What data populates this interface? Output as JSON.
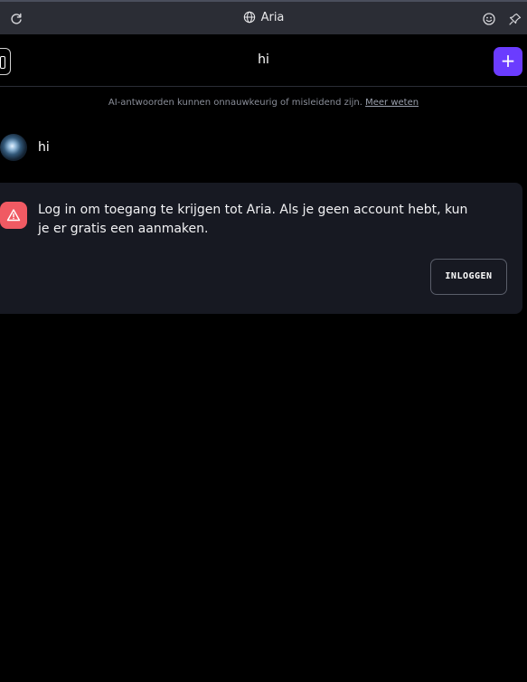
{
  "window": {
    "title": "Aria",
    "icons": {
      "reload": "reload-icon",
      "globe": "globe-icon",
      "emoji": "emoji-icon",
      "pin": "pin-icon"
    }
  },
  "header": {
    "chat_title": "hi",
    "new_chat_symbol": "+"
  },
  "disclaimer": {
    "text": "AI-antwoorden kunnen onnauwkeurig of misleidend zijn.",
    "link": "Meer weten"
  },
  "messages": [
    {
      "role": "user",
      "text": "hi"
    }
  ],
  "login_card": {
    "message": "Log in om toegang te krijgen tot Aria. Als je geen account hebt, kun je er gratis een aanmaken.",
    "button_label": "INLOGGEN",
    "icon": "warning-icon"
  },
  "colors": {
    "background": "#000000",
    "topbar": "#2b2d35",
    "accent": "#6b3cff",
    "card": "#171922",
    "warning": "#f05a63"
  }
}
